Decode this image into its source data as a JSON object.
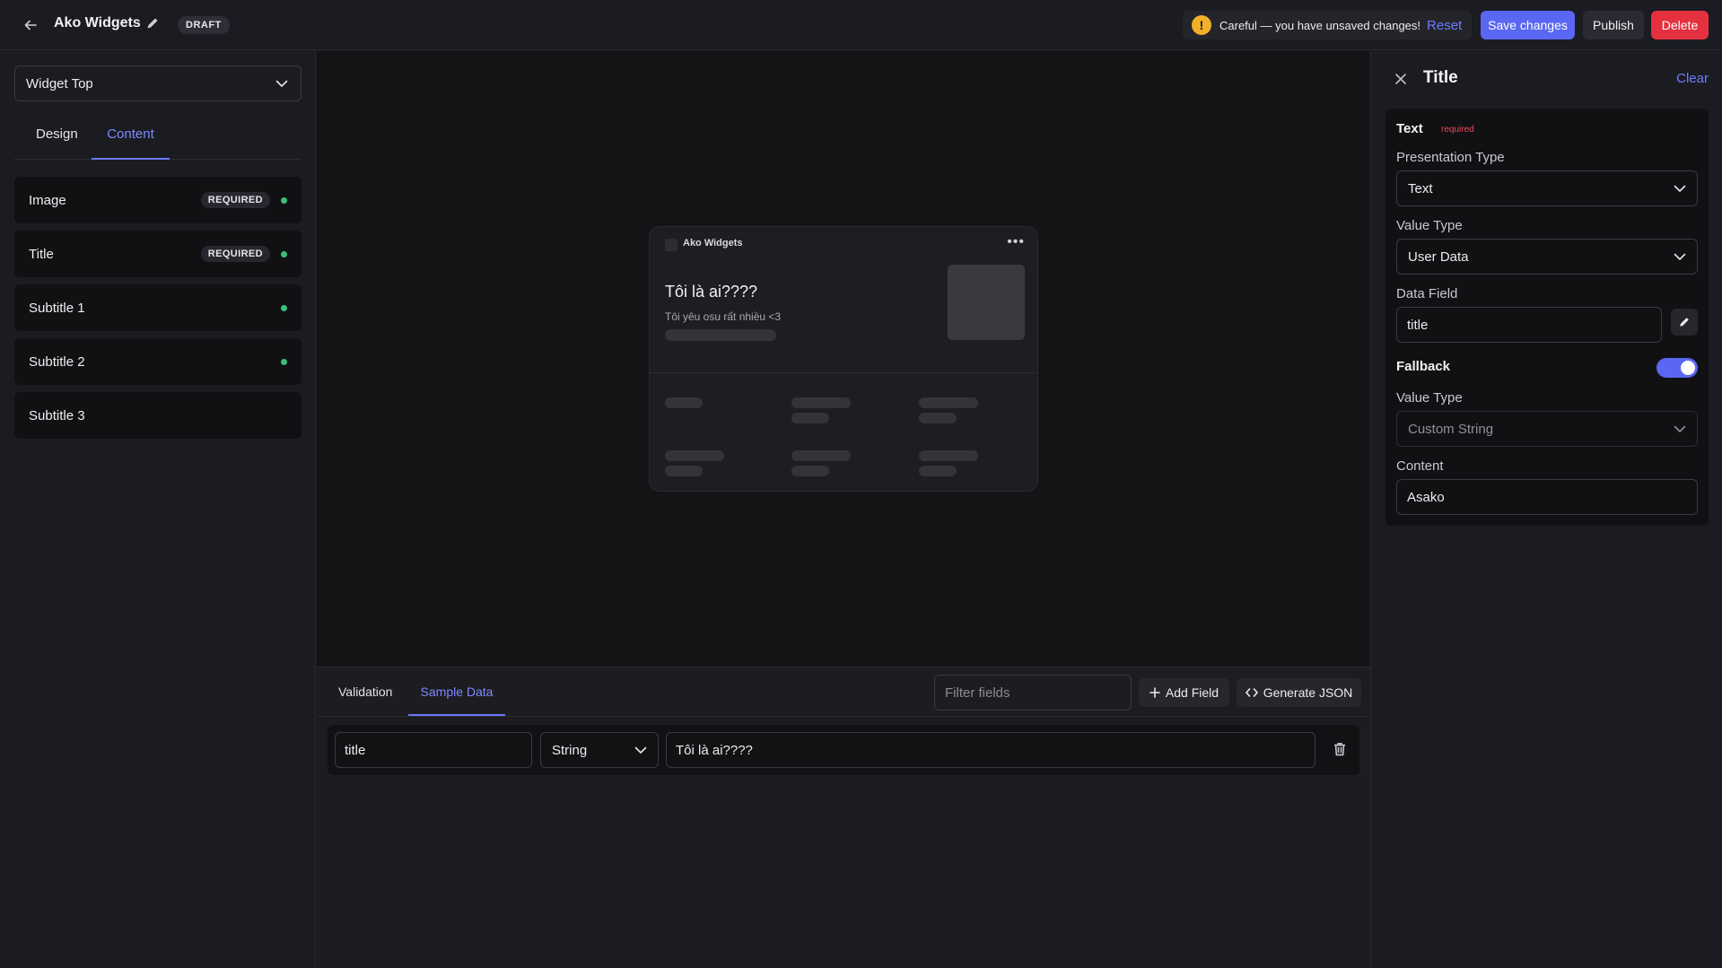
{
  "header": {
    "title": "Ako Widgets",
    "status_badge": "DRAFT",
    "warning_text": "Careful — you have unsaved changes!",
    "warning_icon": "!",
    "reset_label": "Reset",
    "save_label": "Save changes",
    "publish_label": "Publish",
    "delete_label": "Delete"
  },
  "sidebar": {
    "widget_select": "Widget Top",
    "tabs": [
      "Design",
      "Content"
    ],
    "active_tab": "Content",
    "fields": [
      {
        "label": "Image",
        "badge": "REQUIRED",
        "dot": true
      },
      {
        "label": "Title",
        "badge": "REQUIRED",
        "dot": true
      },
      {
        "label": "Subtitle 1",
        "badge": "",
        "dot": true
      },
      {
        "label": "Subtitle 2",
        "badge": "",
        "dot": true
      },
      {
        "label": "Subtitle 3",
        "badge": "",
        "dot": false
      }
    ]
  },
  "preview": {
    "brand": "Ako Widgets",
    "more": "•••",
    "title": "Tôi là ai????",
    "subtitle": "Tôi yêu osu rất nhiều <3"
  },
  "bottom": {
    "tabs": [
      "Validation",
      "Sample Data"
    ],
    "active_tab": "Sample Data",
    "filter_placeholder": "Filter fields",
    "add_field_label": "Add Field",
    "generate_json_label": "Generate JSON",
    "rows": [
      {
        "key": "title",
        "type": "String",
        "value": "Tôi là ai????"
      }
    ]
  },
  "right_panel": {
    "title": "Title",
    "clear_label": "Clear",
    "section_title": "Text",
    "required_tag": "required",
    "presentation_type_label": "Presentation Type",
    "presentation_type": "Text",
    "value_type_label": "Value Type",
    "value_type": "User Data",
    "data_field_label": "Data Field",
    "data_field": "title",
    "fallback_label": "Fallback",
    "fallback_enabled": true,
    "fallback_value_type_label": "Value Type",
    "fallback_value_type": "Custom String",
    "content_label": "Content",
    "content_value": "Asako"
  },
  "colors": {
    "accent": "#5a67f2",
    "accent_text": "#7d89ff",
    "danger": "#e5303f",
    "warning": "#f2b02a",
    "success_dot": "#39c07a"
  }
}
